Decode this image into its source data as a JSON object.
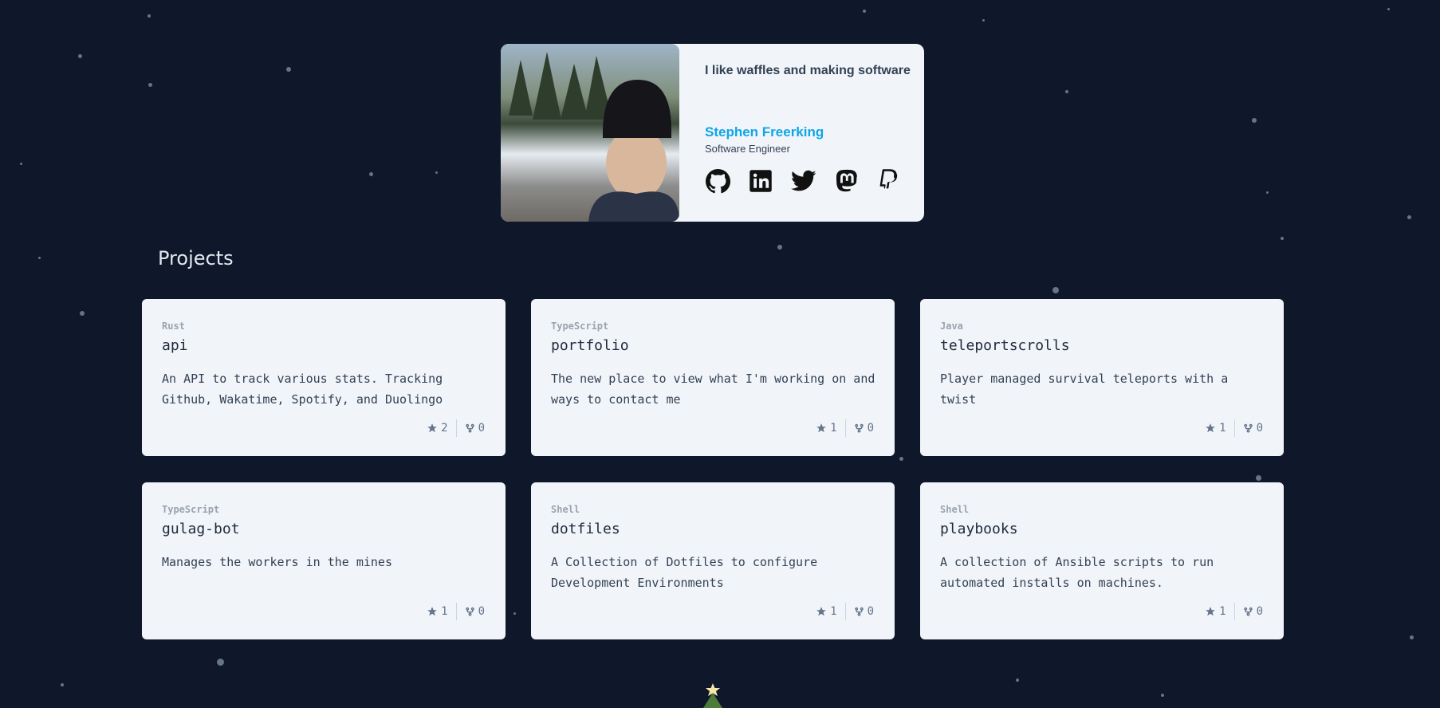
{
  "profile": {
    "tagline": "I like waffles and making software",
    "name": "Stephen Freerking",
    "role": "Software Engineer",
    "socials": [
      "github-icon",
      "linkedin-icon",
      "twitter-icon",
      "mastodon-icon",
      "paypal-icon"
    ]
  },
  "projects_heading": "Projects",
  "projects": [
    {
      "language": "Rust",
      "name": "api",
      "description": "An API to track various stats. Tracking Github, Wakatime, Spotify, and Duolingo",
      "stars": "2",
      "forks": "0"
    },
    {
      "language": "TypeScript",
      "name": "portfolio",
      "description": "The new place to view what I'm working on and ways to contact me",
      "stars": "1",
      "forks": "0"
    },
    {
      "language": "Java",
      "name": "teleportscrolls",
      "description": "Player managed survival teleports with a twist",
      "stars": "1",
      "forks": "0"
    },
    {
      "language": "TypeScript",
      "name": "gulag-bot",
      "description": "Manages the workers in the mines",
      "stars": "1",
      "forks": "0"
    },
    {
      "language": "Shell",
      "name": "dotfiles",
      "description": "A Collection of Dotfiles to configure Development Environments",
      "stars": "1",
      "forks": "0"
    },
    {
      "language": "Shell",
      "name": "playbooks",
      "description": "A collection of Ansible scripts to run automated installs on machines.",
      "stars": "1",
      "forks": "0"
    }
  ],
  "colors": {
    "background": "#0f172a",
    "card": "#f1f5f9",
    "accent": "#0ea5e9"
  }
}
